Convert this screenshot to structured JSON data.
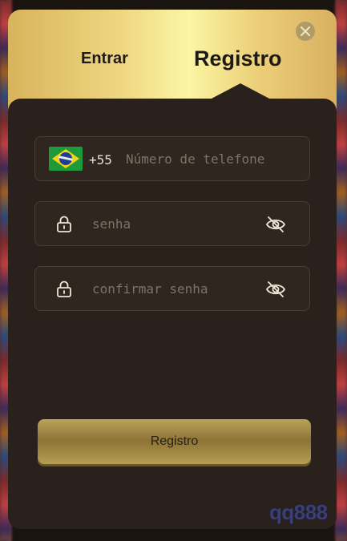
{
  "tabs": {
    "login_label": "Entrar",
    "register_label": "Registro"
  },
  "phone": {
    "country_flag": "brazil-flag-icon",
    "country_code": "+55",
    "placeholder": "Número de telefone"
  },
  "password": {
    "placeholder": "senha"
  },
  "confirm_password": {
    "placeholder": "confirmar senha"
  },
  "submit_label": "Registro",
  "brand": "qq888",
  "icons": {
    "close": "close-icon",
    "lock": "lock-icon",
    "eye": "eye-off-icon"
  },
  "colors": {
    "header_gold": "#efd782",
    "panel_bg": "#2a211c",
    "button_gold": "#8d7336",
    "brand_text": "#3a3f78"
  }
}
